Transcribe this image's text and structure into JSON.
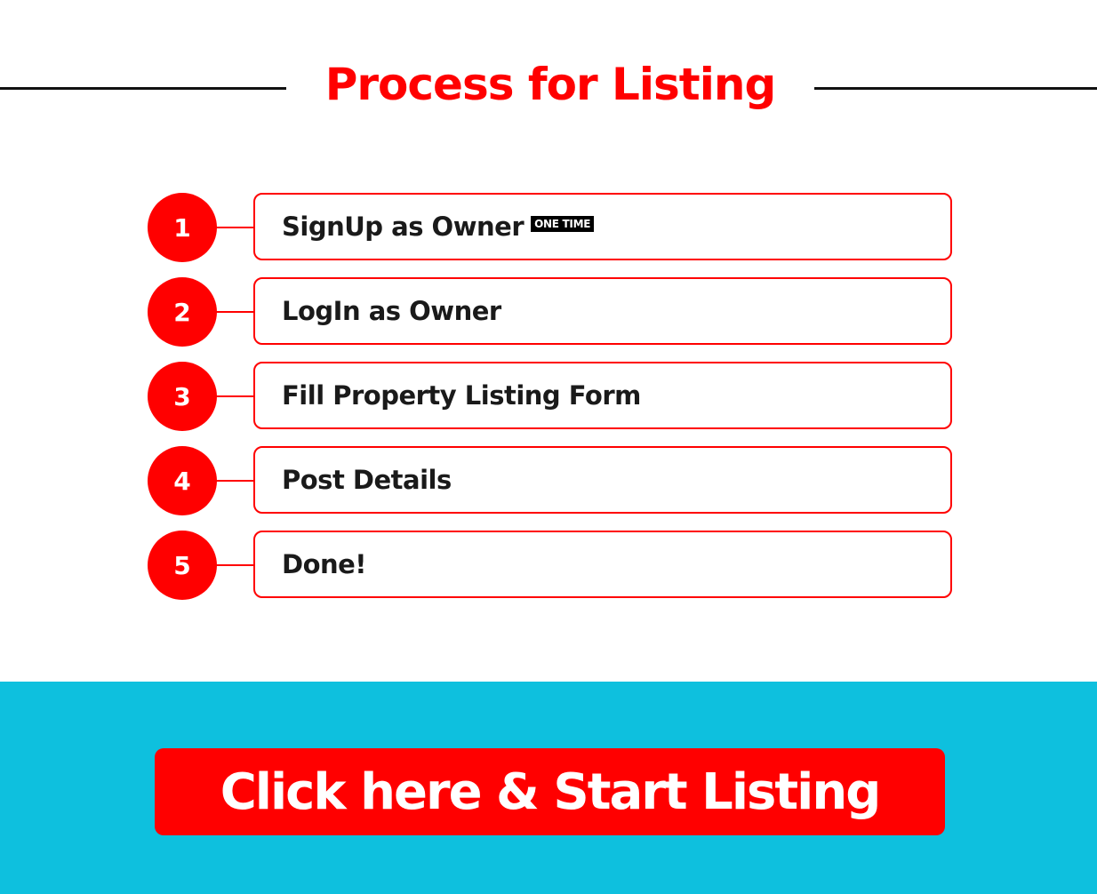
{
  "header": {
    "title": "Process for Listing"
  },
  "steps": [
    {
      "number": "1",
      "label": "SignUp as Owner",
      "badge": "ONE TIME"
    },
    {
      "number": "2",
      "label": "LogIn as Owner"
    },
    {
      "number": "3",
      "label": "Fill Property Listing Form"
    },
    {
      "number": "4",
      "label": "Post Details"
    },
    {
      "number": "5",
      "label": "Done!"
    }
  ],
  "cta": {
    "label": "Click here & Start Listing"
  },
  "colors": {
    "accent": "#ff0000",
    "band": "#0ec0de",
    "text": "#1a1a1a"
  }
}
